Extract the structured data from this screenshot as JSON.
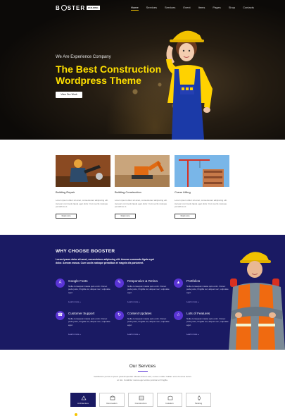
{
  "nav": {
    "logo_left": "B",
    "logo_right": "STER",
    "logo_tag": "BUILDING",
    "items": [
      {
        "label": "Home",
        "active": true
      },
      {
        "label": "Services",
        "active": false
      },
      {
        "label": "Services",
        "active": false
      },
      {
        "label": "Event",
        "active": false
      },
      {
        "label": "Items",
        "active": false
      },
      {
        "label": "Pages",
        "active": false
      },
      {
        "label": "Shop",
        "active": false
      },
      {
        "label": "Contacts",
        "active": false
      }
    ]
  },
  "hero": {
    "subtitle": "We Are Experience Company",
    "title": "The Best Construction Wordpress Theme",
    "button": "View Our Work",
    "accent": "#ffe000"
  },
  "cards": [
    {
      "title": "Building Repair",
      "text": "Lorem ipsum dolor sit amet, consectetuer adipiscing elit. Aenean commodo ligula eget dolor. Cum sociis natoque penatibus et.",
      "button": "Read more"
    },
    {
      "title": "Building Construction",
      "text": "Lorem ipsum dolor sit amet, consectetuer adipiscing elit. Aenean commodo ligula eget dolor. Cum sociis natoque penatibus et.",
      "button": "Read more"
    },
    {
      "title": "Crane Lifting",
      "text": "Lorem ipsum dolor sit amet, consectetuer adipiscing elit. Aenean commodo ligula eget dolor. Cum sociis natoque penatibus et.",
      "button": "Read more"
    }
  ],
  "why": {
    "title": "WHY CHOOSE BOOSTER",
    "description": "Lorem ipsum dolor sit amet, consectetuer adipiscing elit. Aenean commodo ligula eget dolor. Aenean massa. Cum sociis natoque penatibus et magnis dis parturient.",
    "background": "#1a1a63",
    "icon_color": "#5a34d6",
    "features": [
      {
        "icon": "A",
        "title": "Google Fonts",
        "text": "Nulla consequat massa quis enim. Donec pede justo, fringilla vel, aliquet nec, vulputate eget.",
        "link": "Learn more »"
      },
      {
        "icon": "✎",
        "title": "Responsive & Retina",
        "text": "Nulla consequat massa quis enim. Donec pede justo, fringilla vel, aliquet nec, vulputate eget.",
        "link": "Learn more »"
      },
      {
        "icon": "▲",
        "title": "Portfolios",
        "text": "Nulla consequat massa quis enim. Donec pede justo, fringilla vel, aliquet nec, vulputate eget.",
        "link": "Learn more »"
      },
      {
        "icon": "☎",
        "title": "Customer Support",
        "text": "Nulla consequat massa quis enim. Donec pede justo, fringilla vel, aliquet nec, vulputate eget.",
        "link": "Learn more »"
      },
      {
        "icon": "↻",
        "title": "Content Updates",
        "text": "Nulla consequat massa quis enim. Donec pede justo, fringilla vel, aliquet nec, vulputate eget.",
        "link": "Learn more »"
      },
      {
        "icon": "☆",
        "title": "Lots of Features",
        "text": "Nulla consequat massa quis enim. Donec pede justo, fringilla vel, aliquet nec, vulputate eget.",
        "link": "Learn more »"
      }
    ]
  },
  "services": {
    "title": "Our Services",
    "description": "Vestibulum purus et ipsum pede/imperdiet. Mauris dictum sed, cursus mollis. Nullam eros rhoncus luctus at nisi. Curabitur metus eget varius pulvinar et fringilla.",
    "tabs": [
      {
        "label": "Architecture",
        "active": true
      },
      {
        "label": "Renovation",
        "active": false
      },
      {
        "label": "Construction",
        "active": false
      },
      {
        "label": "Isolation",
        "active": false
      },
      {
        "label": "Tanking",
        "active": false
      }
    ]
  }
}
